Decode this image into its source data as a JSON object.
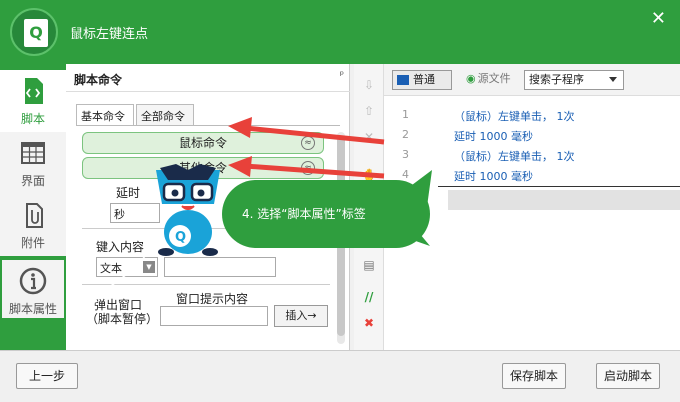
{
  "window": {
    "title": "鼠标左键连点",
    "close_label": "✕"
  },
  "logo": {
    "letter": "Q"
  },
  "sidebar": {
    "items": [
      {
        "label": "脚本",
        "icon": "code-file-icon"
      },
      {
        "label": "界面",
        "icon": "grid-layout-icon"
      },
      {
        "label": "附件",
        "icon": "attachment-icon"
      },
      {
        "label": "脚本属性",
        "icon": "info-icon"
      }
    ]
  },
  "panel": {
    "title": "脚本命令",
    "pin": "ᵖ",
    "tabs": [
      "基本命令",
      "全部命令"
    ],
    "commands": [
      {
        "label": "鼠标命令",
        "chevron": "≈"
      },
      {
        "label": "其他命令",
        "chevron": "≈"
      }
    ],
    "delay_label": "延时",
    "delay_unit": "秒",
    "key_input_label": "键入内容",
    "key_input_type": "文本",
    "popup_label_1": "弹出窗口",
    "popup_label_2": "（脚本暂停）",
    "popup_content_label": "窗口提示内容",
    "insert_label": "插入→"
  },
  "toolbar": {
    "icons": [
      "arrow-down-icon",
      "arrow-up-icon",
      "delete-icon",
      "hand-icon",
      "paste-icon",
      "comment-icon",
      "uncomment-icon"
    ]
  },
  "editor": {
    "modes": {
      "normal": "普通",
      "source": "源文件"
    },
    "sub_select": "搜索子程序",
    "lines": [
      {
        "num": "1",
        "text": "（鼠标）左键单击， 1次"
      },
      {
        "num": "2",
        "text": "延时 1000 毫秒"
      },
      {
        "num": "3",
        "text": "（鼠标）左键单击， 1次"
      },
      {
        "num": "4",
        "text": "延时 1000 毫秒"
      }
    ]
  },
  "tutorial": {
    "step_text": "4. 选择“脚本属性”标签"
  },
  "bottom": {
    "prev": "上一步",
    "save": "保存脚本",
    "start": "启动脚本"
  },
  "colors": {
    "brand": "#2f9e3e",
    "arrow": "#e8413a",
    "code": "#1a5fb4"
  }
}
